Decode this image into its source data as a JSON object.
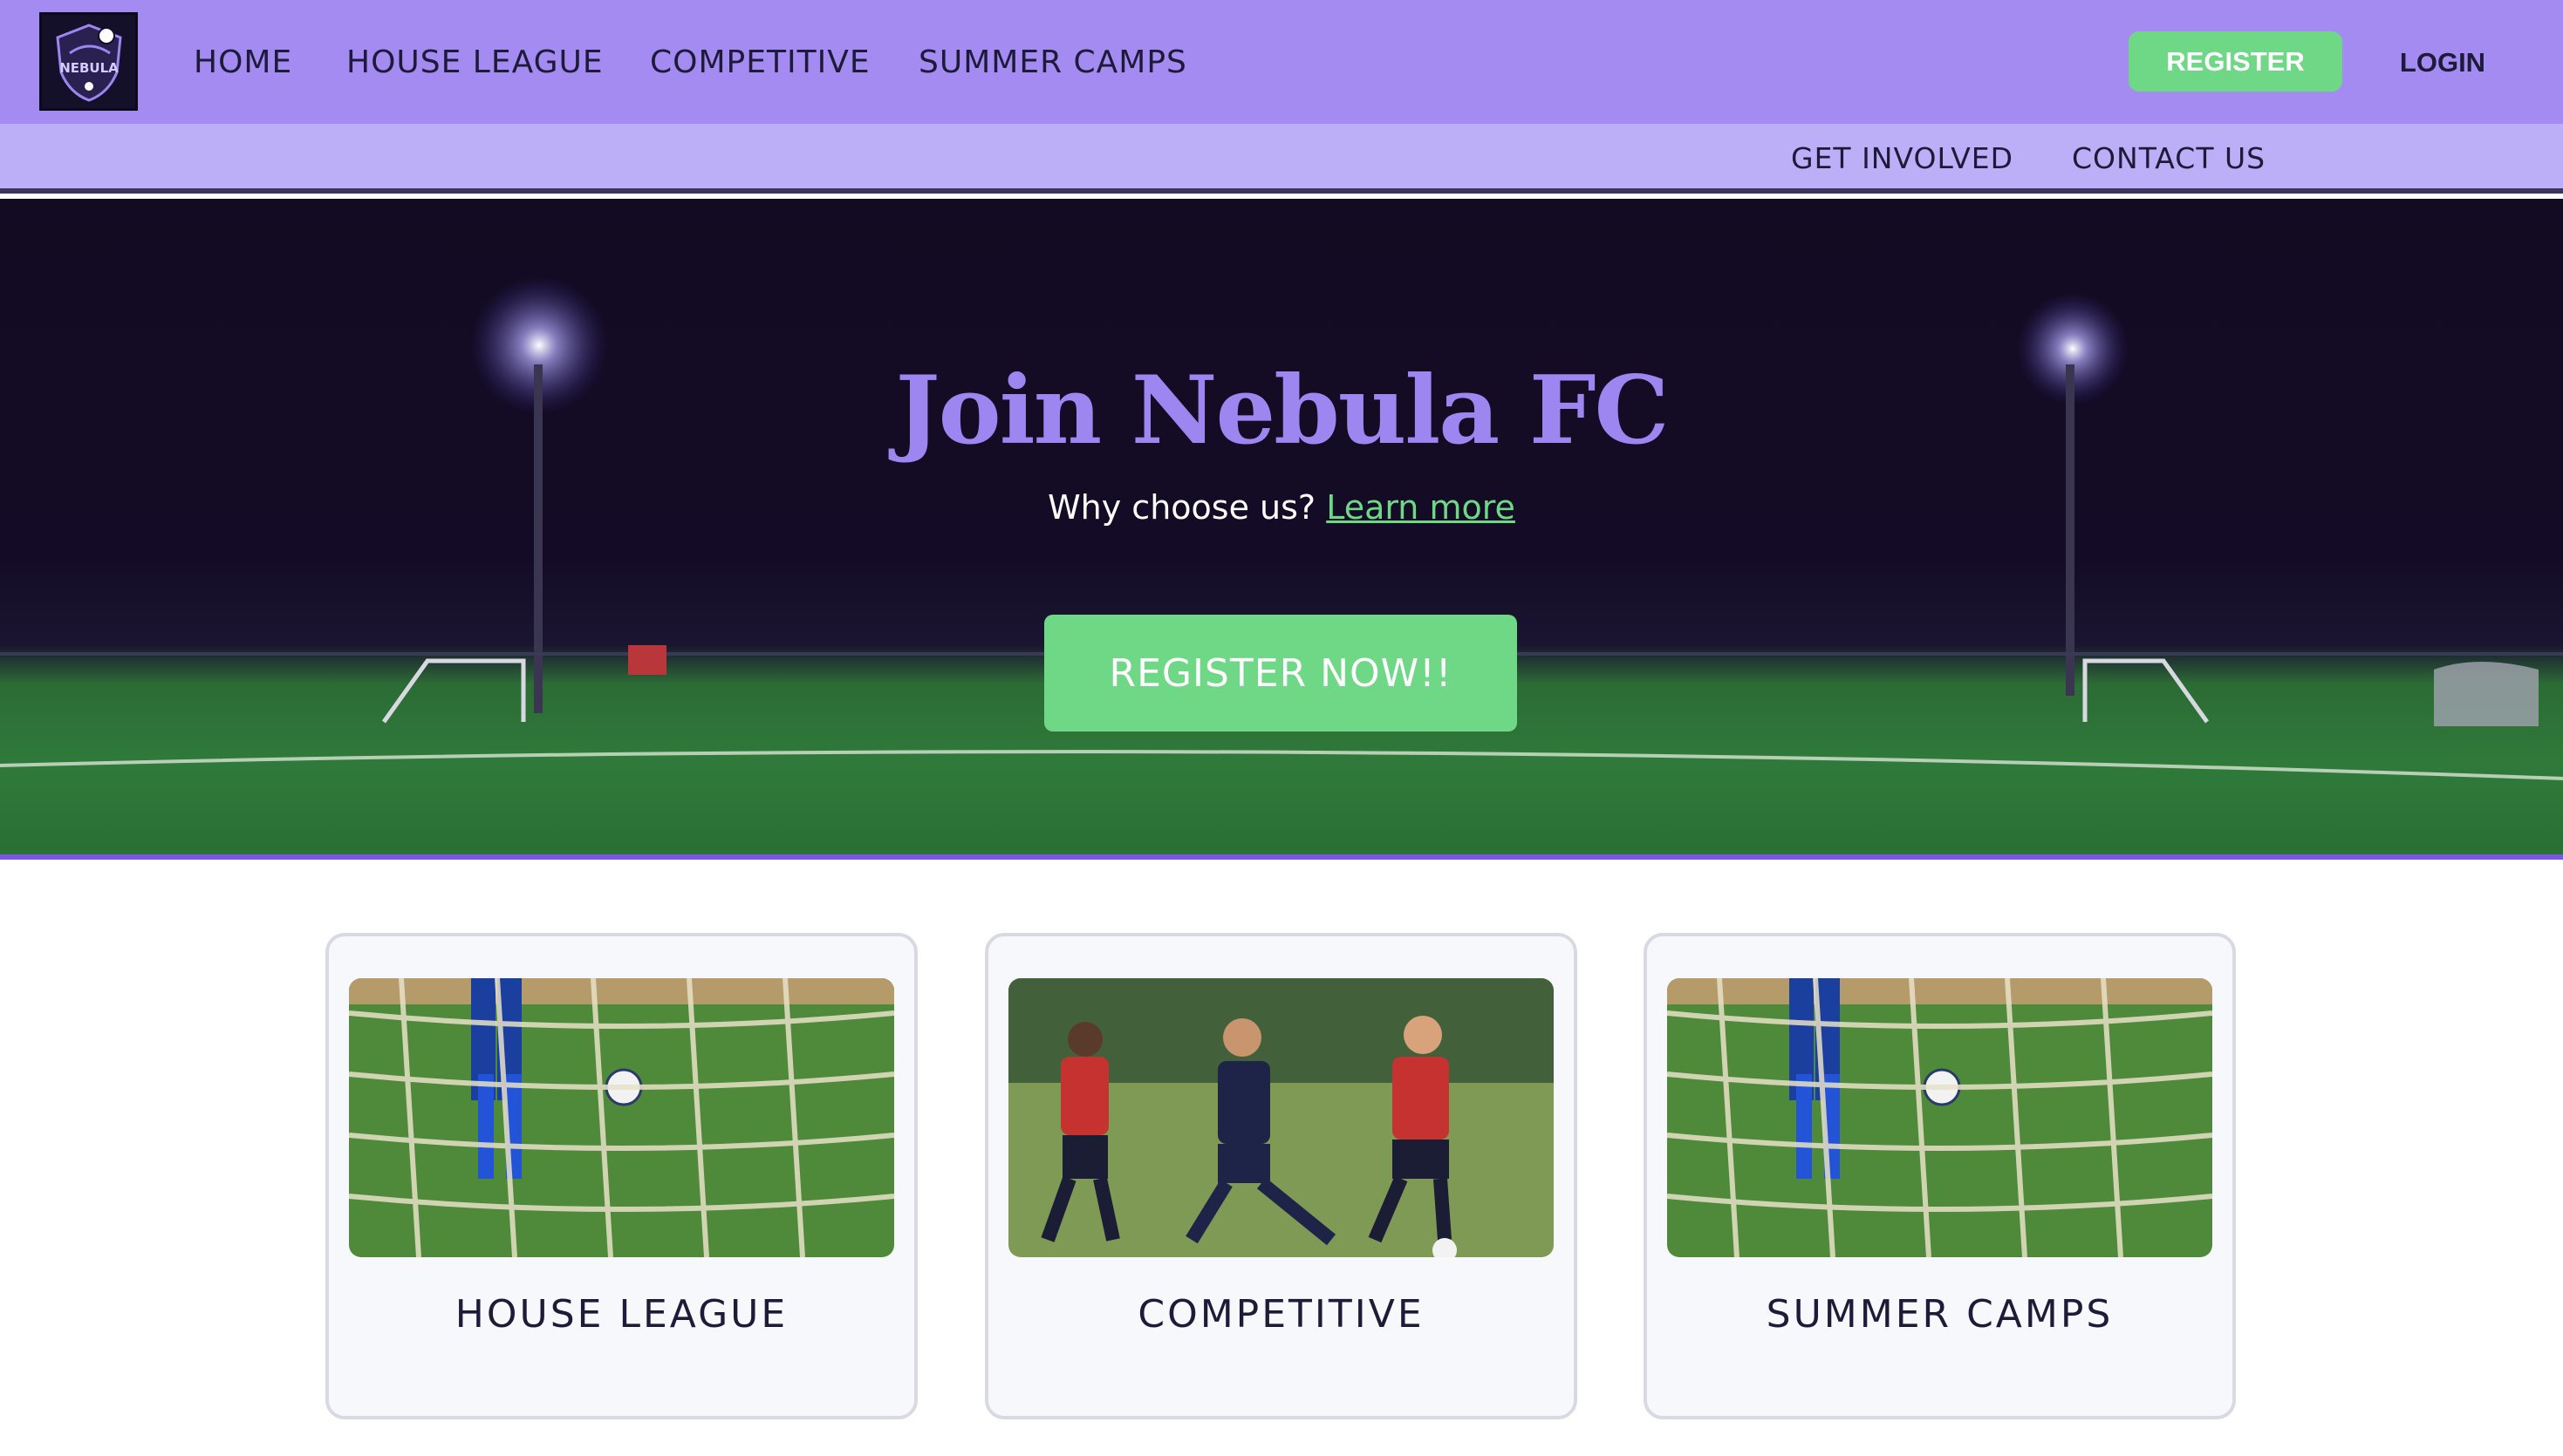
{
  "brand": {
    "logo_text": "NEBULA",
    "logo_icon": "soccer-crest-icon"
  },
  "topnav": {
    "links": [
      "HOME",
      "HOUSE LEAGUE",
      "COMPETITIVE",
      "SUMMER CAMPS"
    ],
    "register_label": "REGISTER",
    "login_label": "LOGIN"
  },
  "subnav": {
    "links": [
      "GET INVOLVED",
      "CONTACT US"
    ]
  },
  "hero": {
    "title": "Join Nebula FC",
    "subtitle": "Why choose us?",
    "learn_more": "Learn more",
    "cta": "REGISTER NOW!!"
  },
  "cards": [
    {
      "title": "HOUSE LEAGUE",
      "image": "goal-net-soccer-photo"
    },
    {
      "title": "COMPETITIVE",
      "image": "players-tackle-soccer-photo"
    },
    {
      "title": "SUMMER CAMPS",
      "image": "goal-net-soccer-photo"
    }
  ],
  "colors": {
    "nav_bg": "#a38bf1",
    "subnav_bg": "#bcaef7",
    "accent_green": "#6fd886",
    "title_purple": "#9d86f0",
    "hero_border": "#7b56e6"
  }
}
